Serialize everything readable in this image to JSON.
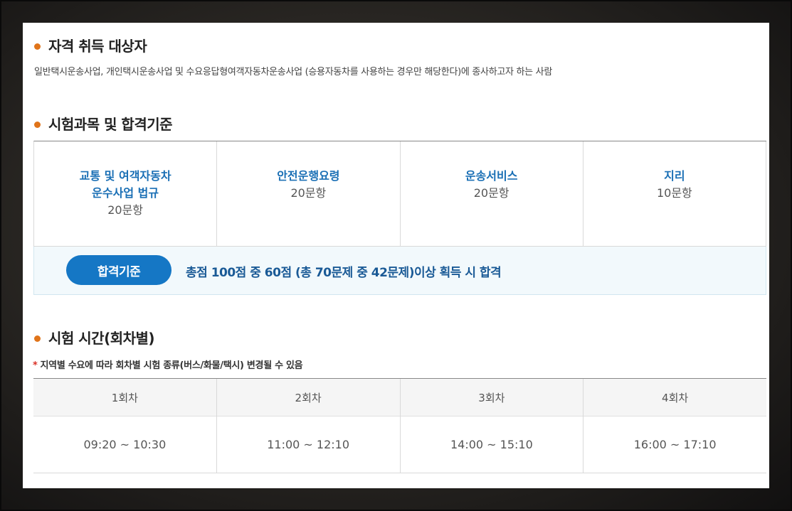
{
  "qualification": {
    "title": "자격 취득 대상자",
    "description": "일반택시운송사업, 개인택시운송사업 및 수요응답형여객자동차운송사업 (승용자동차를 사용하는 경우만 해당한다)에 종사하고자 하는 사람"
  },
  "exam": {
    "title": "시험과목 및 합격기준",
    "subjects": [
      {
        "name": "교통 및 여객자동차\n운수사업 법규",
        "count": "20문항"
      },
      {
        "name": "안전운행요령",
        "count": "20문항"
      },
      {
        "name": "운송서비스",
        "count": "20문항"
      },
      {
        "name": "지리",
        "count": "10문항"
      }
    ],
    "pass_label": "합격기준",
    "pass_text": "총점 100점 중 60점 (총 70문제 중 42문제)이상 획득 시 합격"
  },
  "schedule": {
    "title": "시험 시간(회차별)",
    "note_marker": "*",
    "note": "지역별 수요에 따라 회차별 시험 종류(버스/화물/택시) 변경될 수 있음",
    "sessions": [
      {
        "round": "1회차",
        "time": "09:20 ~ 10:30"
      },
      {
        "round": "2회차",
        "time": "11:00 ~ 12:10"
      },
      {
        "round": "3회차",
        "time": "14:00 ~ 15:10"
      },
      {
        "round": "4회차",
        "time": "16:00 ~ 17:10"
      }
    ]
  },
  "colors": {
    "bullet": "#e0741a",
    "accent_blue": "#1577c5",
    "subject_blue": "#1a6fb5",
    "note_star": "#d93025"
  }
}
